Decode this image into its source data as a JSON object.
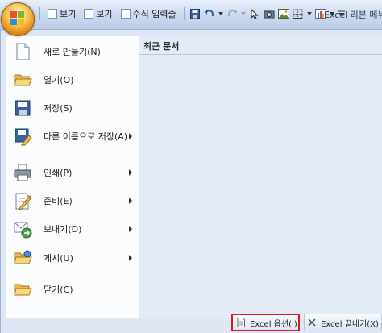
{
  "qat": {
    "checkbox_1_label": "보기",
    "checkbox_2_label": "보기",
    "checkbox_3_label": "수식 입력줄",
    "title": "Excel 리본 메뉴"
  },
  "menu": {
    "items": [
      {
        "label": "새로 만들기(N)",
        "icon": "new-document-icon",
        "has_submenu": false
      },
      {
        "label": "열기(O)",
        "icon": "open-folder-icon",
        "has_submenu": false
      },
      {
        "label": "저장(S)",
        "icon": "save-disk-icon",
        "has_submenu": false
      },
      {
        "label": "다른 이름으로 저장(A)",
        "icon": "save-as-icon",
        "has_submenu": true
      },
      {
        "label": "인쇄(P)",
        "icon": "printer-icon",
        "has_submenu": true
      },
      {
        "label": "준비(E)",
        "icon": "prepare-icon",
        "has_submenu": true
      },
      {
        "label": "보내기(D)",
        "icon": "send-icon",
        "has_submenu": true
      },
      {
        "label": "게시(U)",
        "icon": "publish-icon",
        "has_submenu": true
      },
      {
        "label": "닫기(C)",
        "icon": "close-folder-icon",
        "has_submenu": false
      }
    ]
  },
  "recent": {
    "title": "최근 문서"
  },
  "buttons": {
    "options_label": "Excel 옵션(I)",
    "exit_label": "Excel 끝내기(X)"
  },
  "colors": {
    "highlight_border": "#d51b1b",
    "panel_bg": "#dfe7f4"
  }
}
